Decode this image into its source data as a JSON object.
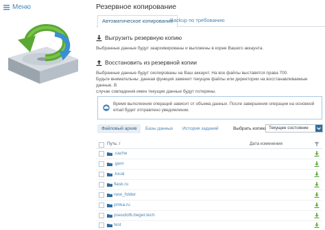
{
  "sidebar": {
    "menu_label": "Меню",
    "icons": {
      "menu": "hamburger-icon",
      "hero": "hard-drive-restore-icon"
    }
  },
  "page": {
    "title": "Резервное копирование",
    "tabs": [
      {
        "label": "Автоматическое копирование",
        "active": true
      },
      {
        "label": "Backup по требованию",
        "active": false
      }
    ]
  },
  "export_section": {
    "heading": "Выгрузить резервную копию",
    "icon": "download-icon",
    "description": "Выбранные данные будут заархивированы и выложены в корне Вашего аккаунта."
  },
  "restore_section": {
    "heading": "Восстановить из резервной копии",
    "icon": "upload-icon",
    "description_lines": [
      "Выбранные данные будут скопированы на Ваш аккаунт. На все файлы выставятся права 700.",
      "Будьте внимательны: данная функция заменит текущие файлы или директории на восстанавливаемые данные. В",
      "случае совпадения имен текущие данные будут потеряны."
    ]
  },
  "info_box": {
    "icon": "cloud-info-icon",
    "lines": [
      "Время выполнения операций зависит от объема данных. После завершения операции на основной",
      "email будет отправлено уведомление."
    ]
  },
  "subtabs": [
    {
      "label": "Файловый архив",
      "active": true
    },
    {
      "label": "Базы данных",
      "active": false
    },
    {
      "label": "История заданий",
      "active": false
    }
  ],
  "select_copy": {
    "label": "Выбрать копию:",
    "value": "Текущее состояние"
  },
  "file_table": {
    "path_header": "Путь: /",
    "date_header": "Дата изменения",
    "rows": [
      {
        "name": ".cache"
      },
      {
        "name": ".gem"
      },
      {
        "name": ".local"
      },
      {
        "name": "flask.ru"
      },
      {
        "name": "new_folder"
      },
      {
        "name": "pmka.ru"
      },
      {
        "name": "pseudofb.beget.tech"
      },
      {
        "name": "test"
      }
    ]
  },
  "colors": {
    "link": "#4a86b6",
    "accent_dark": "#2f6da1",
    "green": "#5aa832",
    "folder": "#2f6da1"
  }
}
